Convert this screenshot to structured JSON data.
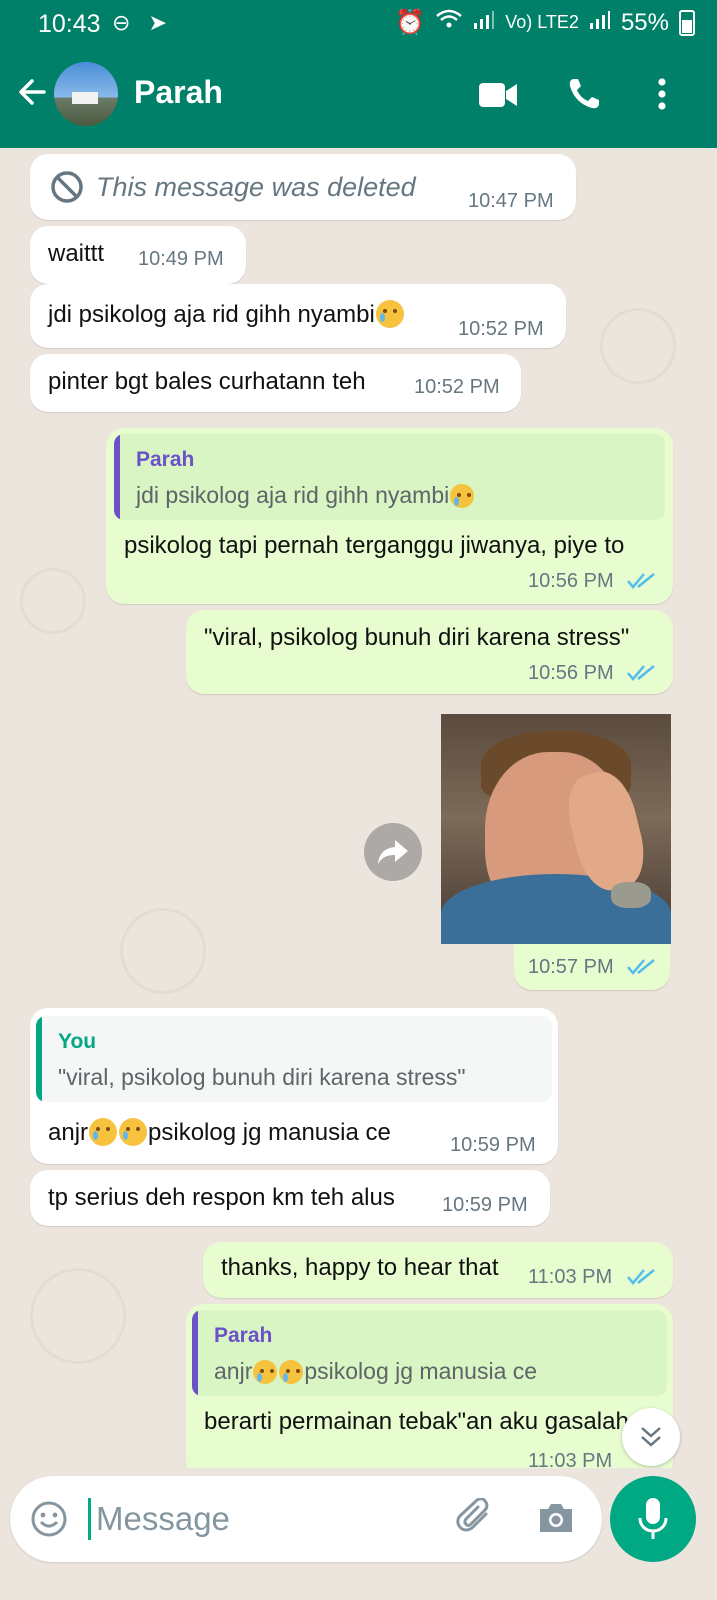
{
  "status_bar": {
    "time": "10:43",
    "network_label": "Vo) LTE2",
    "battery": "55%"
  },
  "header": {
    "contact_name": "Parah",
    "icons": [
      "back-arrow-icon",
      "video-call-icon",
      "voice-call-icon",
      "more-vert-icon"
    ]
  },
  "messages": [
    {
      "direction": "in",
      "text": "This message was deleted",
      "time": "10:47 PM",
      "deleted": true
    },
    {
      "direction": "in",
      "text": "waittt",
      "time": "10:49 PM"
    },
    {
      "direction": "in",
      "text": "jdi psikolog aja rid gihh nyambi",
      "emoji": "crying-face",
      "time": "10:52 PM"
    },
    {
      "direction": "in",
      "text": "pinter bgt bales curhatann teh",
      "time": "10:52 PM"
    },
    {
      "direction": "out",
      "quote_name": "Parah",
      "quote_text": "jdi psikolog aja rid gihh nyambi",
      "text": "psikolog tapi pernah terganggu jiwanya, piye to",
      "time": "10:56 PM"
    },
    {
      "direction": "out",
      "text": "\"viral, psikolog bunuh diri karena stress\"",
      "time": "10:56 PM"
    },
    {
      "direction": "out",
      "type": "image",
      "time": "10:57 PM"
    },
    {
      "direction": "in",
      "quote_name": "You",
      "quote_text": "\"viral, psikolog bunuh diri karena stress\"",
      "text_pre": "anjr",
      "text_post": "psikolog jg manusia ce",
      "time": "10:59 PM"
    },
    {
      "direction": "in",
      "text": "tp serius deh respon km teh alus",
      "time": "10:59 PM"
    },
    {
      "direction": "out",
      "text": "thanks, happy to hear that",
      "time": "11:03 PM"
    },
    {
      "direction": "out",
      "quote_name": "Parah",
      "quote_text_pre": "anjr",
      "quote_text_post": "psikolog jg manusia ce",
      "text": "berarti permainan tebak\"an aku gasalah",
      "time": "11:03 PM"
    }
  ],
  "composer": {
    "placeholder": "Message",
    "icons": [
      "emoji-icon",
      "attach-icon",
      "camera-icon",
      "mic-icon"
    ]
  },
  "colors": {
    "header": "#008069",
    "outgoing_bubble": "#e7fdd0",
    "incoming_bubble": "#ffffff",
    "read_ticks": "#53bdeb",
    "accent": "#00a884"
  }
}
